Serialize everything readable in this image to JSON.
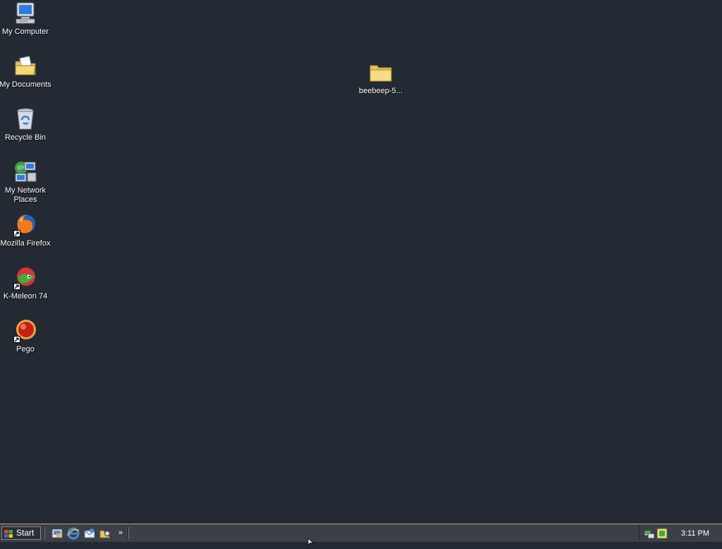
{
  "desktop": {
    "icons": [
      {
        "label": "My Computer",
        "icon": "my-computer-icon"
      },
      {
        "label": "My Documents",
        "icon": "my-documents-icon"
      },
      {
        "label": "Recycle Bin",
        "icon": "recycle-bin-icon"
      },
      {
        "label": "My Network Places",
        "icon": "network-places-icon"
      },
      {
        "label": "Mozilla Firefox",
        "icon": "firefox-icon"
      },
      {
        "label": "K-Meleon 74",
        "icon": "k-meleon-icon"
      },
      {
        "label": "Pego",
        "icon": "pego-icon"
      },
      {
        "label": "beebeep-5...",
        "icon": "folder-icon"
      }
    ]
  },
  "taskbar": {
    "start_label": "Start",
    "quick_launch": [
      {
        "icon": "show-desktop-icon"
      },
      {
        "icon": "internet-explorer-icon"
      },
      {
        "icon": "outlook-express-icon"
      },
      {
        "icon": "windows-explorer-icon"
      }
    ],
    "chevron": "»",
    "tray": [
      {
        "icon": "network-tray-icon"
      },
      {
        "icon": "tray-app-icon"
      }
    ],
    "clock": "3:11 PM"
  },
  "colors": {
    "desktop_bg": "#232a33",
    "taskbar_bg": "#3b4048",
    "taskbar_border": "#b8a765",
    "text": "#ffffff"
  }
}
